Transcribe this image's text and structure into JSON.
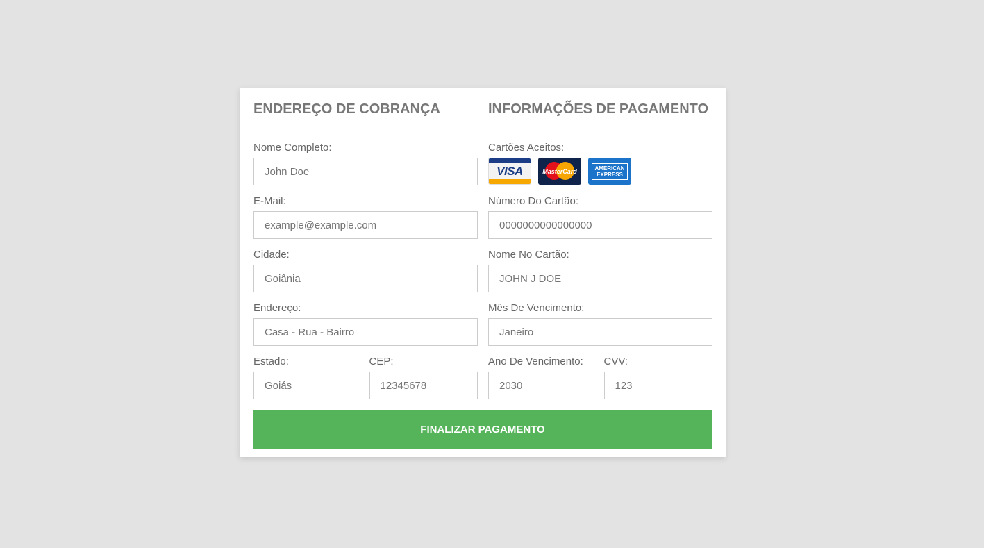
{
  "billing": {
    "title": "ENDEREÇO DE COBRANÇA",
    "full_name": {
      "label": "Nome Completo:",
      "placeholder": "John Doe"
    },
    "email": {
      "label": "E-Mail:",
      "placeholder": "example@example.com"
    },
    "city": {
      "label": "Cidade:",
      "placeholder": "Goiânia"
    },
    "address": {
      "label": "Endereço:",
      "placeholder": "Casa - Rua - Bairro"
    },
    "state": {
      "label": "Estado:",
      "placeholder": "Goiás"
    },
    "zip": {
      "label": "CEP:",
      "placeholder": "12345678"
    }
  },
  "payment": {
    "title": "INFORMAÇÕES DE PAGAMENTO",
    "accepted_cards_label": "Cartões Aceitos:",
    "cards": {
      "visa": "VISA",
      "mastercard": "MasterCard",
      "amex_line1": "AMERICAN",
      "amex_line2": "EXPRESS"
    },
    "card_number": {
      "label": "Número Do Cartão:",
      "placeholder": "0000000000000000"
    },
    "card_name": {
      "label": "Nome No Cartão:",
      "placeholder": "JOHN J DOE"
    },
    "exp_month": {
      "label": "Mês De Vencimento:",
      "placeholder": "Janeiro"
    },
    "exp_year": {
      "label": "Ano De Vencimento:",
      "placeholder": "2030"
    },
    "cvv": {
      "label": "CVV:",
      "placeholder": "123"
    }
  },
  "submit_label": "FINALIZAR PAGAMENTO",
  "colors": {
    "background": "#e3e3e3",
    "button": "#55b45a"
  }
}
